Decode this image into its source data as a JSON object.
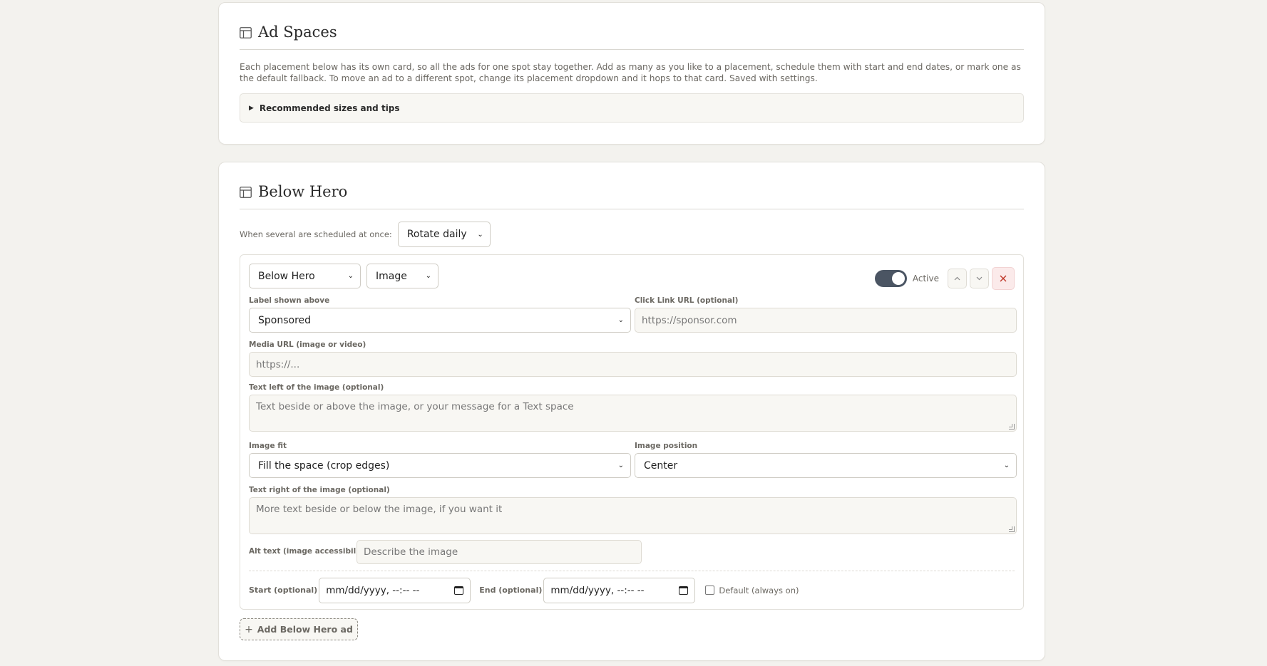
{
  "ad_spaces": {
    "title": "Ad Spaces",
    "description": "Each placement below has its own card, so all the ads for one spot stay together. Add as many as you like to a placement, schedule them with start and end dates, or mark one as the default fallback. To move an ad to a different spot, change its placement dropdown and it hops to that card. Saved with settings.",
    "tips_summary": "Recommended sizes and tips"
  },
  "below_hero": {
    "title": "Below Hero",
    "rotation_label": "When several are scheduled at once:",
    "rotation_value": "Rotate daily",
    "ad": {
      "placement_value": "Below Hero",
      "type_value": "Image",
      "active_label": "Active",
      "active": true,
      "label_shown_above": {
        "label": "Label shown above",
        "value": "Sponsored"
      },
      "click_link": {
        "label": "Click Link URL (optional)",
        "placeholder": "https://sponsor.com"
      },
      "media_url": {
        "label": "Media URL (image or video)",
        "placeholder": "https://..."
      },
      "text_left": {
        "label": "Text left of the image (optional)",
        "placeholder": "Text beside or above the image, or your message for a Text space"
      },
      "image_fit": {
        "label": "Image fit",
        "value": "Fill the space (crop edges)"
      },
      "image_position": {
        "label": "Image position",
        "value": "Center"
      },
      "text_right": {
        "label": "Text right of the image (optional)",
        "placeholder": "More text beside or below the image, if you want it"
      },
      "alt_text": {
        "label": "Alt text (image accessibility)",
        "placeholder": "Describe the image"
      },
      "start": {
        "label": "Start (optional)",
        "value": "mm/dd/yyyy, --:-- --"
      },
      "end": {
        "label": "End (optional)",
        "value": "mm/dd/yyyy, --:-- --"
      },
      "default_label": "Default (always on)",
      "default_checked": false
    },
    "add_button": "Add Below Hero ad"
  },
  "icons": {
    "up": "chevron-up-icon",
    "down": "chevron-down-icon",
    "delete": "close-icon",
    "section": "layout-icon"
  },
  "colors": {
    "background": "#f3f2ee",
    "card": "#ffffff",
    "toggle_on": "#4b5563",
    "delete": "#c0392b"
  }
}
